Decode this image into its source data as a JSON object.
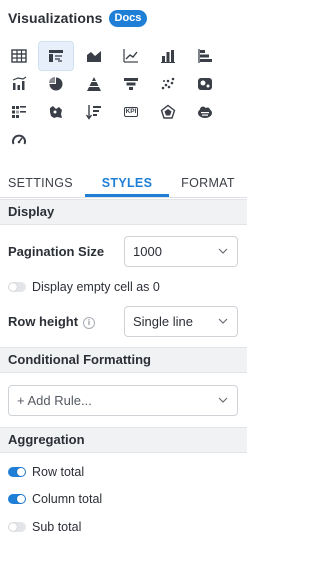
{
  "header": {
    "title": "Visualizations",
    "docs_badge": "Docs"
  },
  "viz_types": [
    {
      "icon": "table-icon",
      "active": false
    },
    {
      "icon": "pivot-table-icon",
      "active": true
    },
    {
      "icon": "area-chart-icon",
      "active": false
    },
    {
      "icon": "line-chart-icon",
      "active": false
    },
    {
      "icon": "column-chart-icon",
      "active": false
    },
    {
      "icon": "bar-chart-icon",
      "active": false
    },
    {
      "icon": "combo-chart-icon",
      "active": false
    },
    {
      "icon": "pie-chart-icon",
      "active": false
    },
    {
      "icon": "pyramid-chart-icon",
      "active": false
    },
    {
      "icon": "funnel-chart-icon",
      "active": false
    },
    {
      "icon": "scatter-chart-icon",
      "active": false
    },
    {
      "icon": "bubble-map-icon",
      "active": false
    },
    {
      "icon": "heatmap-icon",
      "active": false
    },
    {
      "icon": "map-icon",
      "active": false
    },
    {
      "icon": "sort-bars-icon",
      "active": false
    },
    {
      "icon": "kpi-icon",
      "active": false,
      "text": "KPI"
    },
    {
      "icon": "radar-chart-icon",
      "active": false
    },
    {
      "icon": "word-cloud-icon",
      "active": false
    },
    {
      "icon": "gauge-icon",
      "active": false
    }
  ],
  "tabs": [
    {
      "label": "SETTINGS",
      "active": false
    },
    {
      "label": "STYLES",
      "active": true
    },
    {
      "label": "FORMAT",
      "active": false
    }
  ],
  "display": {
    "heading": "Display",
    "pagination_label": "Pagination Size",
    "pagination_value": "1000",
    "empty_cell_label": "Display empty cell as 0",
    "empty_cell_on": false,
    "row_height_label": "Row height",
    "row_height_value": "Single line"
  },
  "conditional": {
    "heading": "Conditional Formatting",
    "add_rule": "+ Add Rule..."
  },
  "aggregation": {
    "heading": "Aggregation",
    "items": [
      {
        "label": "Row total",
        "on": true
      },
      {
        "label": "Column total",
        "on": true
      },
      {
        "label": "Sub total",
        "on": false
      }
    ]
  },
  "colors": {
    "accent": "#1f7fd6",
    "icon": "#3a3f47"
  }
}
